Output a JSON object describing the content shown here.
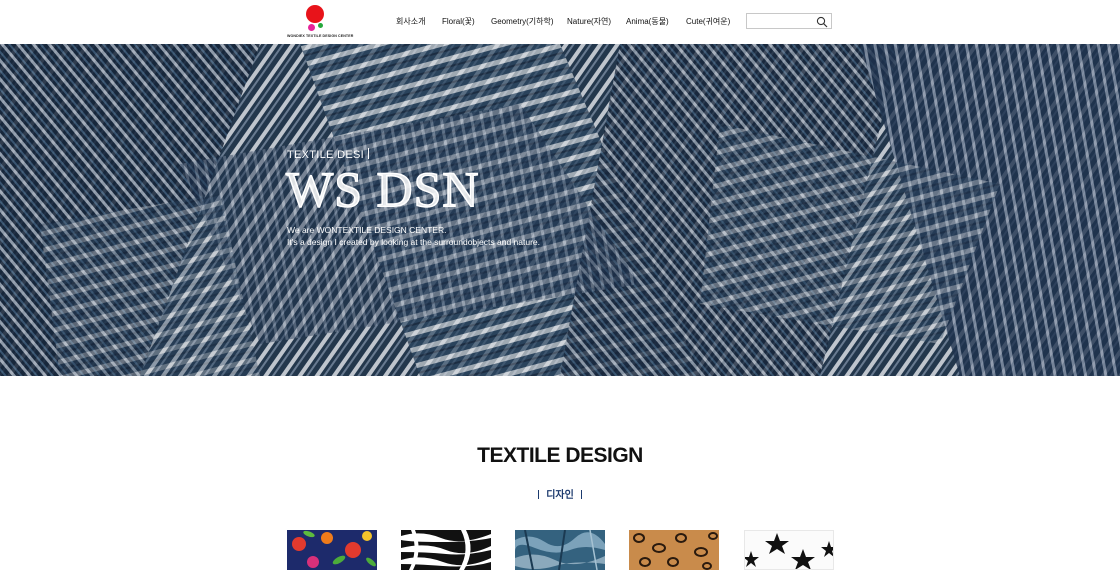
{
  "header": {
    "logo_text": "WONDIEX TEXTILE DESIGN CENTER",
    "nav": [
      {
        "label": "회사소개"
      },
      {
        "label": "Floral(꽃)"
      },
      {
        "label": "Geometry(기하학)"
      },
      {
        "label": "Nature(자연)"
      },
      {
        "label": "Anima(동물)"
      },
      {
        "label": "Cute(귀여운)"
      }
    ],
    "search": {
      "value": "",
      "placeholder": ""
    }
  },
  "hero": {
    "eyebrow": "TEXTILE DESI",
    "title": "WS DSN",
    "desc_line1": "We are WONTEXTILE DESIGN CENTER.",
    "desc_line2": "It's a design I created by looking at the surroundobjects and nature."
  },
  "section": {
    "title": "TEXTILE DESIGN",
    "subtitle": "디자인"
  },
  "colors": {
    "accent": "#1c3a6e",
    "logo_red": "#e8131a",
    "logo_pink": "#e6249a",
    "logo_green": "#26a83c"
  }
}
